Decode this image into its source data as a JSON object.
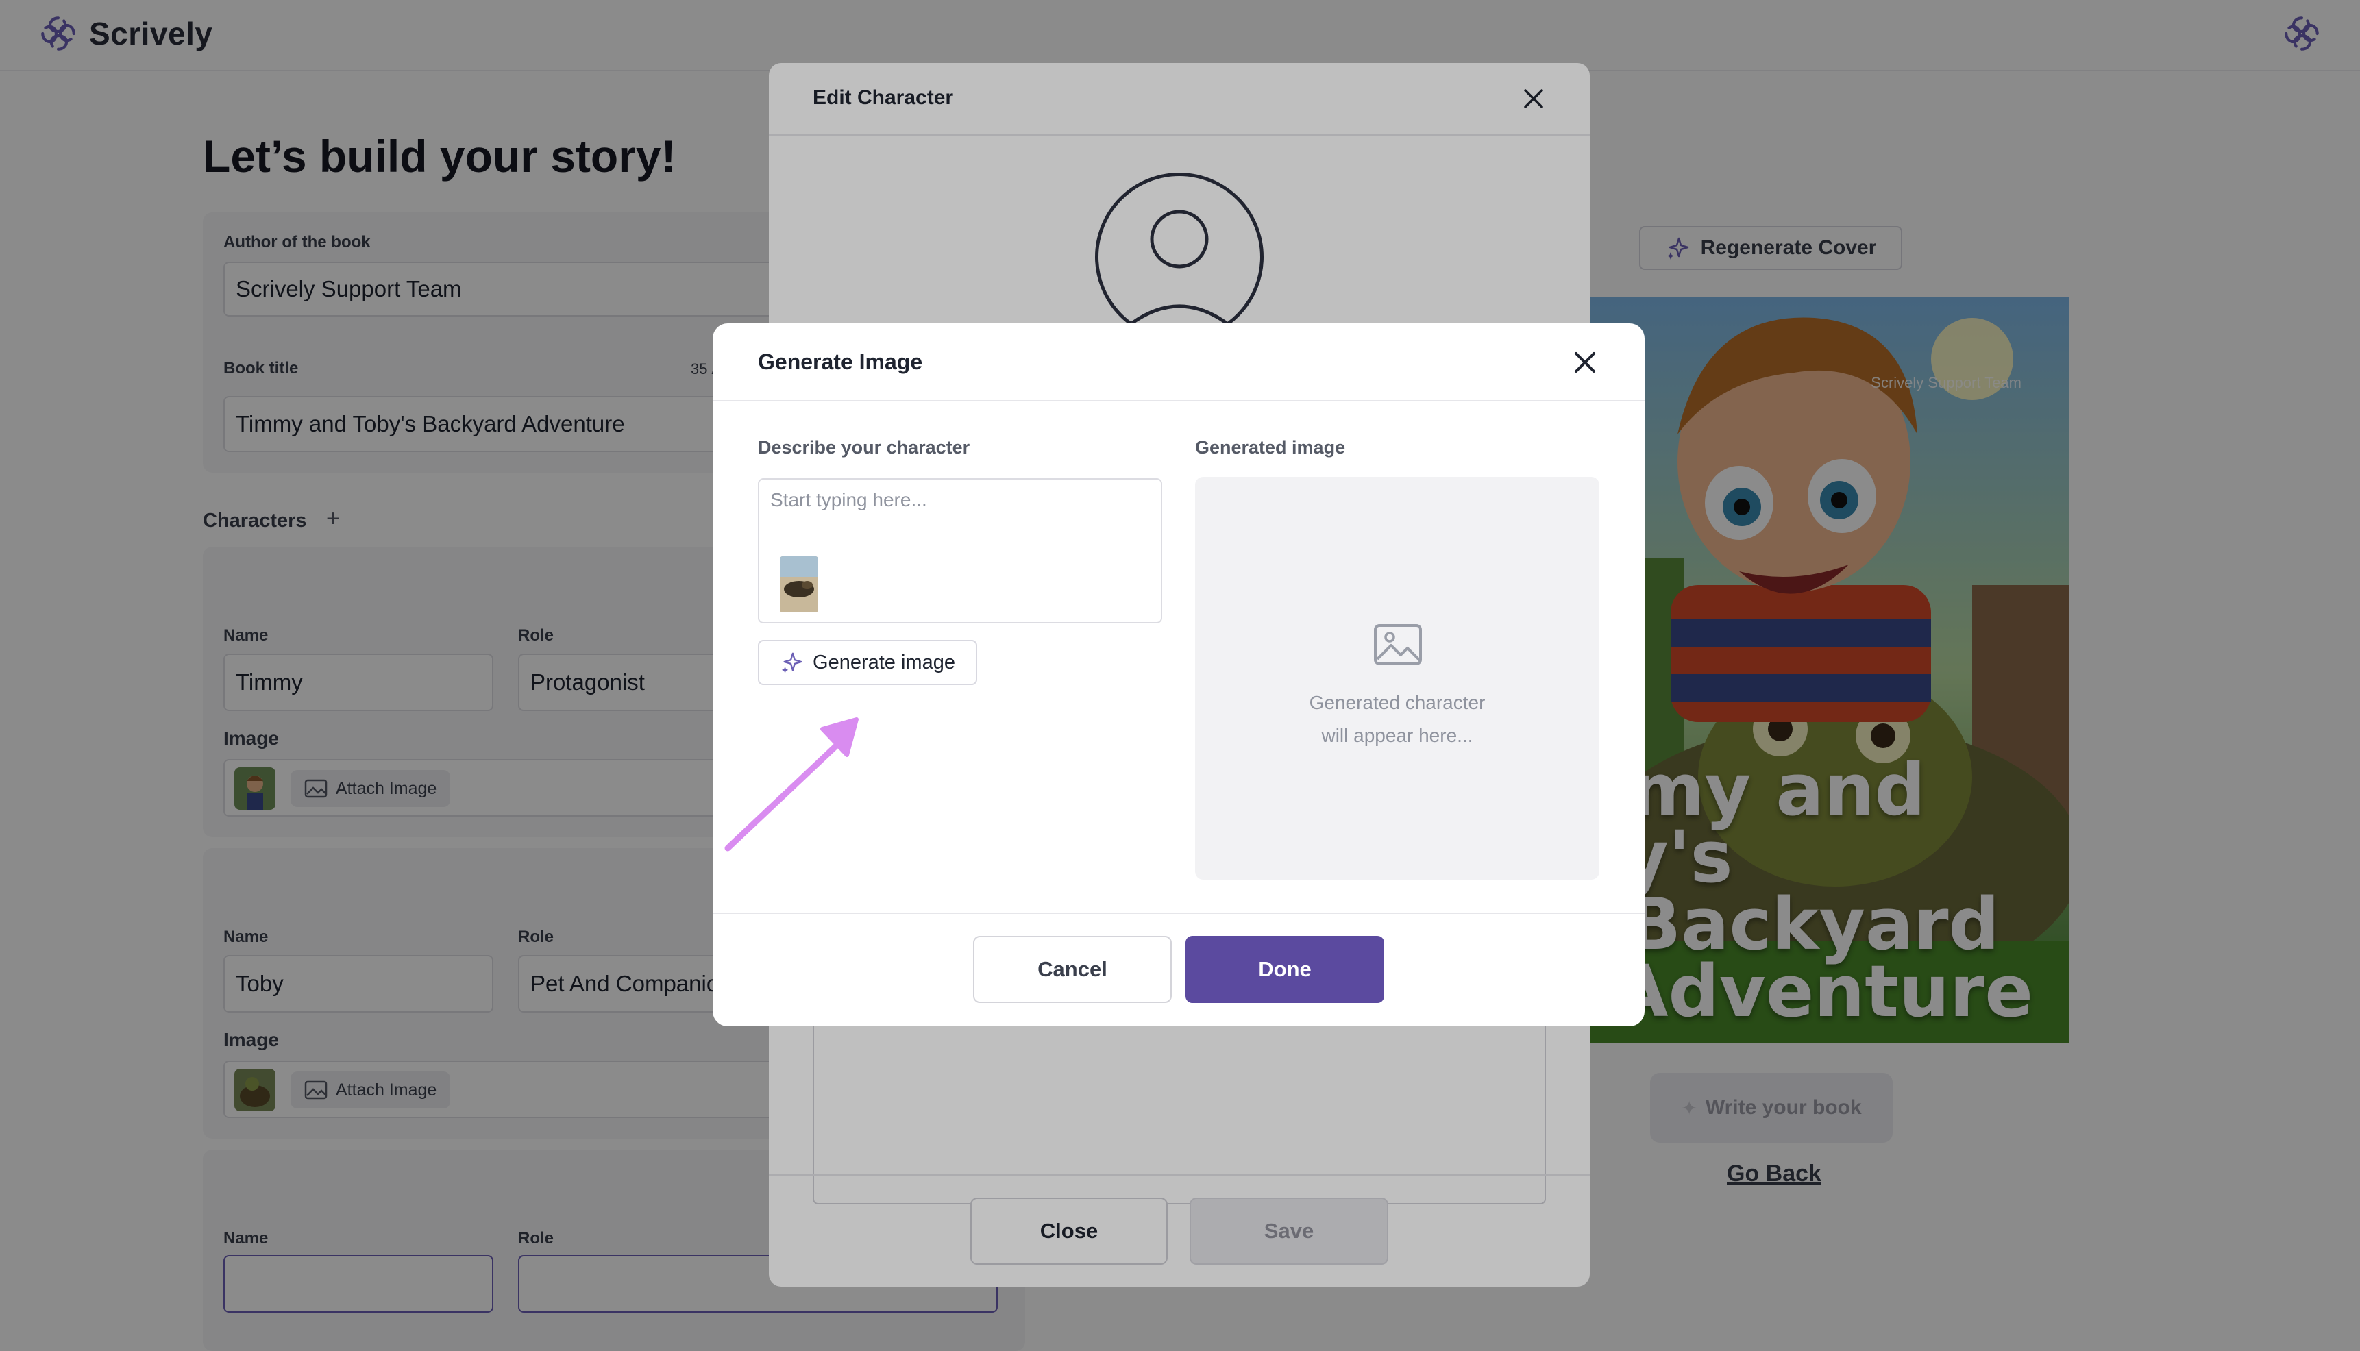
{
  "app": {
    "brand": "Scrively",
    "colors": {
      "accent": "#5b4a9f",
      "logo": "#6b5fb5",
      "annotation": "#d98cf0"
    }
  },
  "page": {
    "title": "Let’s build your story!",
    "author_label": "Author of the book",
    "author_value": "Scrively Support Team",
    "book_title_label": "Book title",
    "book_title_counter": "35 /",
    "book_title_value": "Timmy and Toby's Backyard Adventure",
    "characters_label": "Characters",
    "characters": [
      {
        "name_label": "Name",
        "name": "Timmy",
        "role_label": "Role",
        "role": "Protagonist",
        "image_label": "Image",
        "attach_label": "Attach Image"
      },
      {
        "name_label": "Name",
        "name": "Toby",
        "role_label": "Role",
        "role": "Pet And Companion",
        "image_label": "Image",
        "attach_label": "Attach Image"
      },
      {
        "name_label": "Name",
        "name": "",
        "role_label": "Role",
        "role": ""
      }
    ]
  },
  "cover": {
    "regenerate_label": "Regenerate Cover",
    "author_text": "Scrively Support Team",
    "title_lines": [
      "Timmy and Toby's",
      "Backyard",
      "Adventure"
    ],
    "write_label": "Write your book",
    "go_back_label": "Go Back"
  },
  "edit_modal": {
    "title": "Edit Character",
    "close_label": "Close",
    "save_label": "Save"
  },
  "generate_modal": {
    "title": "Generate Image",
    "describe_label": "Describe your character",
    "describe_placeholder": "Start typing here...",
    "describe_value": "",
    "generate_button": "Generate image",
    "generated_label": "Generated image",
    "preview_line1": "Generated character",
    "preview_line2": "will appear here...",
    "cancel_label": "Cancel",
    "done_label": "Done"
  }
}
